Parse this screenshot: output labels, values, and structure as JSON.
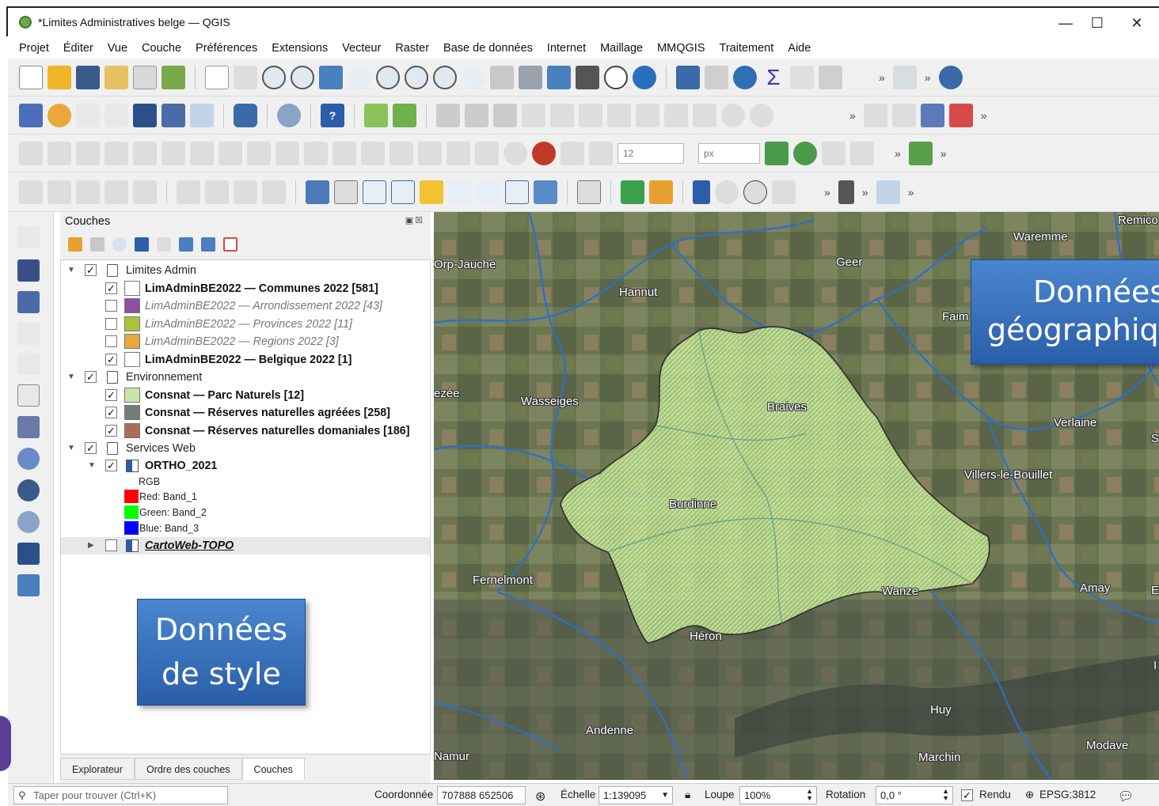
{
  "window": {
    "title": "*Limites Administratives belge — QGIS",
    "controls": {
      "minimize": "—",
      "maximize": "☐",
      "close": "✕"
    }
  },
  "menu": [
    "Projet",
    "Éditer",
    "Vue",
    "Couche",
    "Préférences",
    "Extensions",
    "Vecteur",
    "Raster",
    "Base de données",
    "Internet",
    "Maillage",
    "MMQGIS",
    "Traitement",
    "Aide"
  ],
  "toolbar3": {
    "size_value": "12",
    "unit_value": "px"
  },
  "layers_panel": {
    "title": "Couches",
    "tree": [
      {
        "label": "Limites Admin",
        "checked": true,
        "style": "group"
      },
      {
        "label": "LimAdminBE2022 — Communes 2022 [581]",
        "checked": true,
        "style": "bold",
        "color": "#ffffff"
      },
      {
        "label": "LimAdminBE2022 — Arrondissement 2022 [43]",
        "checked": false,
        "style": "italic",
        "color": "#8e4fa3"
      },
      {
        "label": "LimAdminBE2022 — Provinces 2022 [11]",
        "checked": false,
        "style": "italic",
        "color": "#a9c43c"
      },
      {
        "label": "LimAdminBE2022 — Regions 2022 [3]",
        "checked": false,
        "style": "italic",
        "color": "#e8a93a"
      },
      {
        "label": "LimAdminBE2022 — Belgique 2022 [1]",
        "checked": true,
        "style": "bold",
        "color": "#ffffff"
      },
      {
        "label": "Environnement",
        "checked": true,
        "style": "group"
      },
      {
        "label": "Consnat — Parc Naturels [12]",
        "checked": true,
        "style": "bold",
        "color": "#c9e6a8"
      },
      {
        "label": "Consnat — Réserves naturelles agréées [258]",
        "checked": true,
        "style": "bold",
        "color": "#6f7f78"
      },
      {
        "label": "Consnat — Réserves naturelles domaniales [186]",
        "checked": true,
        "style": "bold",
        "color": "#a77056"
      },
      {
        "label": "Services Web",
        "checked": true,
        "style": "group"
      },
      {
        "label": "ORTHO_2021",
        "checked": true,
        "style": "bold"
      },
      {
        "label": "RGB",
        "style": "legend"
      },
      {
        "label": "Red:  Band_1",
        "style": "legend",
        "color": "#ff0000"
      },
      {
        "label": "Green: Band_2",
        "style": "legend",
        "color": "#00ff00"
      },
      {
        "label": "Blue:  Band_3",
        "style": "legend",
        "color": "#0000ff"
      },
      {
        "label": "CartoWeb-TOPO",
        "checked": false,
        "style": "bold-italic-underline"
      }
    ],
    "tabs": [
      "Explorateur",
      "Ordre des couches",
      "Couches"
    ],
    "active_tab": "Couches"
  },
  "map": {
    "labels": [
      "Orp-Jauche",
      "Hannut",
      "Geer",
      "Waremme",
      "Remico",
      "Faim",
      "ezée",
      "Wasseiges",
      "Braives",
      "Verlaine",
      "S",
      "Villers-le-Bouillet",
      "Burdinne",
      "Fernelmont",
      "Wanze",
      "Amay",
      "E",
      "Héron",
      "Huy",
      "Andenne",
      "Namur",
      "Marchin",
      "Modave",
      "I"
    ]
  },
  "callouts": {
    "geo": [
      "Données",
      "géographiq"
    ],
    "style": [
      "Données",
      "de style"
    ]
  },
  "status": {
    "search_placeholder": "Taper pour trouver (Ctrl+K)",
    "coord_label": "Coordonnée",
    "coord_value": "707888  652506",
    "scale_label": "Échelle",
    "scale_value": "1:139095",
    "magnifier_label": "Loupe",
    "magnifier_value": "100%",
    "rotation_label": "Rotation",
    "rotation_value": "0,0 °",
    "render_label": "Rendu",
    "crs": "EPSG:3812"
  }
}
